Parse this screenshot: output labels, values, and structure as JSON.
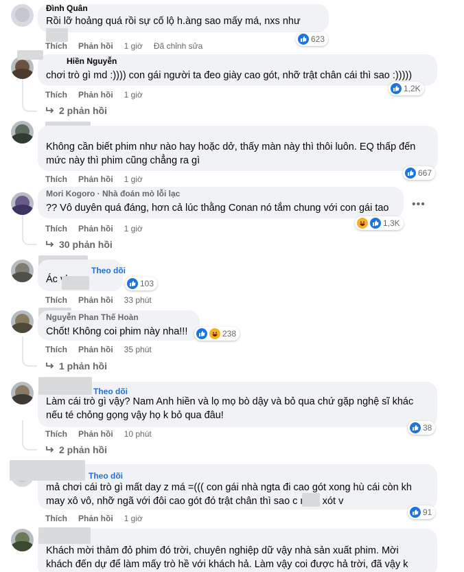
{
  "actions": {
    "like": "Thích",
    "reply": "Phản hồi"
  },
  "colors": {
    "bubble": "#f0f2f5",
    "link": "#216fdb",
    "muted": "#65676b",
    "like_blue": "#1b74e4"
  },
  "comments": [
    {
      "name": "Đình Quân",
      "text1": "Rồi lỡ hoảng quá rồi sự cố lộ h.àng sao mấy má, nxs như",
      "text2": "",
      "time": "1 giờ",
      "edited": "Đã chỉnh sửa",
      "count": "623",
      "replies": "",
      "follow": ""
    },
    {
      "name": "Hiền Nguyễn",
      "text1": "chơi trò gì md :)))) con gái người ta đeo giày cao gót, nhỡ trật chân cái thì sao :)))))",
      "text2": "",
      "time": "1 giờ",
      "count": "1,2K",
      "replies": "2 phản hồi",
      "follow": ""
    },
    {
      "name": "",
      "text1": "Không cần biết phim như nào hay hoặc dở, thấy màn này thì thôi luôn. EQ thấp đến",
      "text2": "mức này thì phim cũng chẳng ra gì",
      "time": "1 giờ",
      "count": "667",
      "replies": "",
      "follow": ""
    },
    {
      "name": "Mori Kogoro · Nhà đoán mò lỗi lạc",
      "text1": "?? Vô duyên quá đáng, hơn cả lúc thằng Conan nó tắm chung với con gái tao",
      "text2": "",
      "time": "1 giờ",
      "count": "1,3K",
      "replies": "30 phản hồi",
      "follow": "",
      "more": "•••"
    },
    {
      "name": "",
      "text1": "Ác vl",
      "text2": "",
      "time": "33 phút",
      "count": "103",
      "replies": "",
      "follow": "Theo dõi"
    },
    {
      "name": "Nguyễn Phan Thế Hoàn",
      "text1": "Chốt! Không coi phim này nha!!!",
      "text2": "",
      "time": "35 phút",
      "count": "238",
      "replies": "1 phản hồi",
      "follow": ""
    },
    {
      "name": "",
      "text1": "Làm cái trò gì vậy? Nam Anh hiền và lọ mọ bò dậy và bỏ qua chứ gặp nghệ sĩ khác",
      "text2": "nếu té chỏng gọng vậy họ k bỏ qua đâu!",
      "time": "10 phút",
      "count": "38",
      "replies": "2 phản hồi",
      "follow": "Theo dõi"
    },
    {
      "name": "",
      "text1": "mả chơi cái trò gì mất day z má =((( con gái nhà ngta đi cao gót xong hù cái còn kh",
      "text2": "may xô vô, nhỡ ngã với đôi cao gót đó trật chân thì sao c   nhìn xót v",
      "time": "1 giờ",
      "count": "91",
      "replies": "",
      "follow": "Theo dõi"
    },
    {
      "name": "",
      "text1": "Khách mời thảm đỏ phim đó trời, chuyên nghiệp dữ vậy nhà sản xuất phim. Mời",
      "text2": "khách đến dự để làm mấy trò hề với khách hả. Làm vậy coi được hả trời, đã vậy k",
      "time": "",
      "count": "",
      "replies": "",
      "follow": ""
    }
  ]
}
